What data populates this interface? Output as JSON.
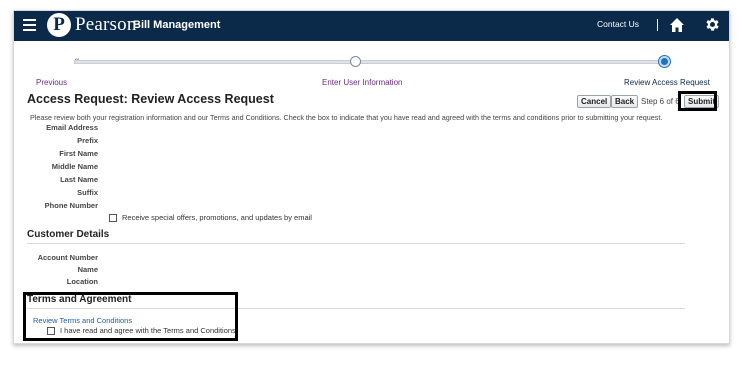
{
  "header": {
    "logo_letter": "P",
    "brand": "Pearson",
    "product": "Bill Management",
    "contact_label": "Contact Us"
  },
  "train": {
    "prev_arrow": "«",
    "previous_label": "Previous",
    "middle_label": "Enter User Information",
    "current_label": "Review Access Request"
  },
  "page": {
    "title": "Access Request: Review Access Request",
    "cancel_label": "Cancel",
    "back_label": "Back",
    "step_text": "Step 6 of 6",
    "submit_label": "Submit",
    "instructions": "Please review both your registration information and our Terms and Conditions. Check the box to indicate that you have read and agreed with the terms and conditions prior to submitting your request."
  },
  "registration": {
    "labels": [
      "Email Address",
      "Prefix",
      "First Name",
      "Middle Name",
      "Last Name",
      "Suffix",
      "Phone Number"
    ],
    "offers_checkbox_label": "Receive special offers, promotions, and updates by email"
  },
  "customer": {
    "section_title": "Customer Details",
    "labels": [
      "Account Number",
      "Name",
      "Location"
    ]
  },
  "terms": {
    "section_title": "Terms and Agreement",
    "link_label": "Review Terms and Conditions",
    "agree_label": "I have read and agree with the Terms and Conditions."
  }
}
